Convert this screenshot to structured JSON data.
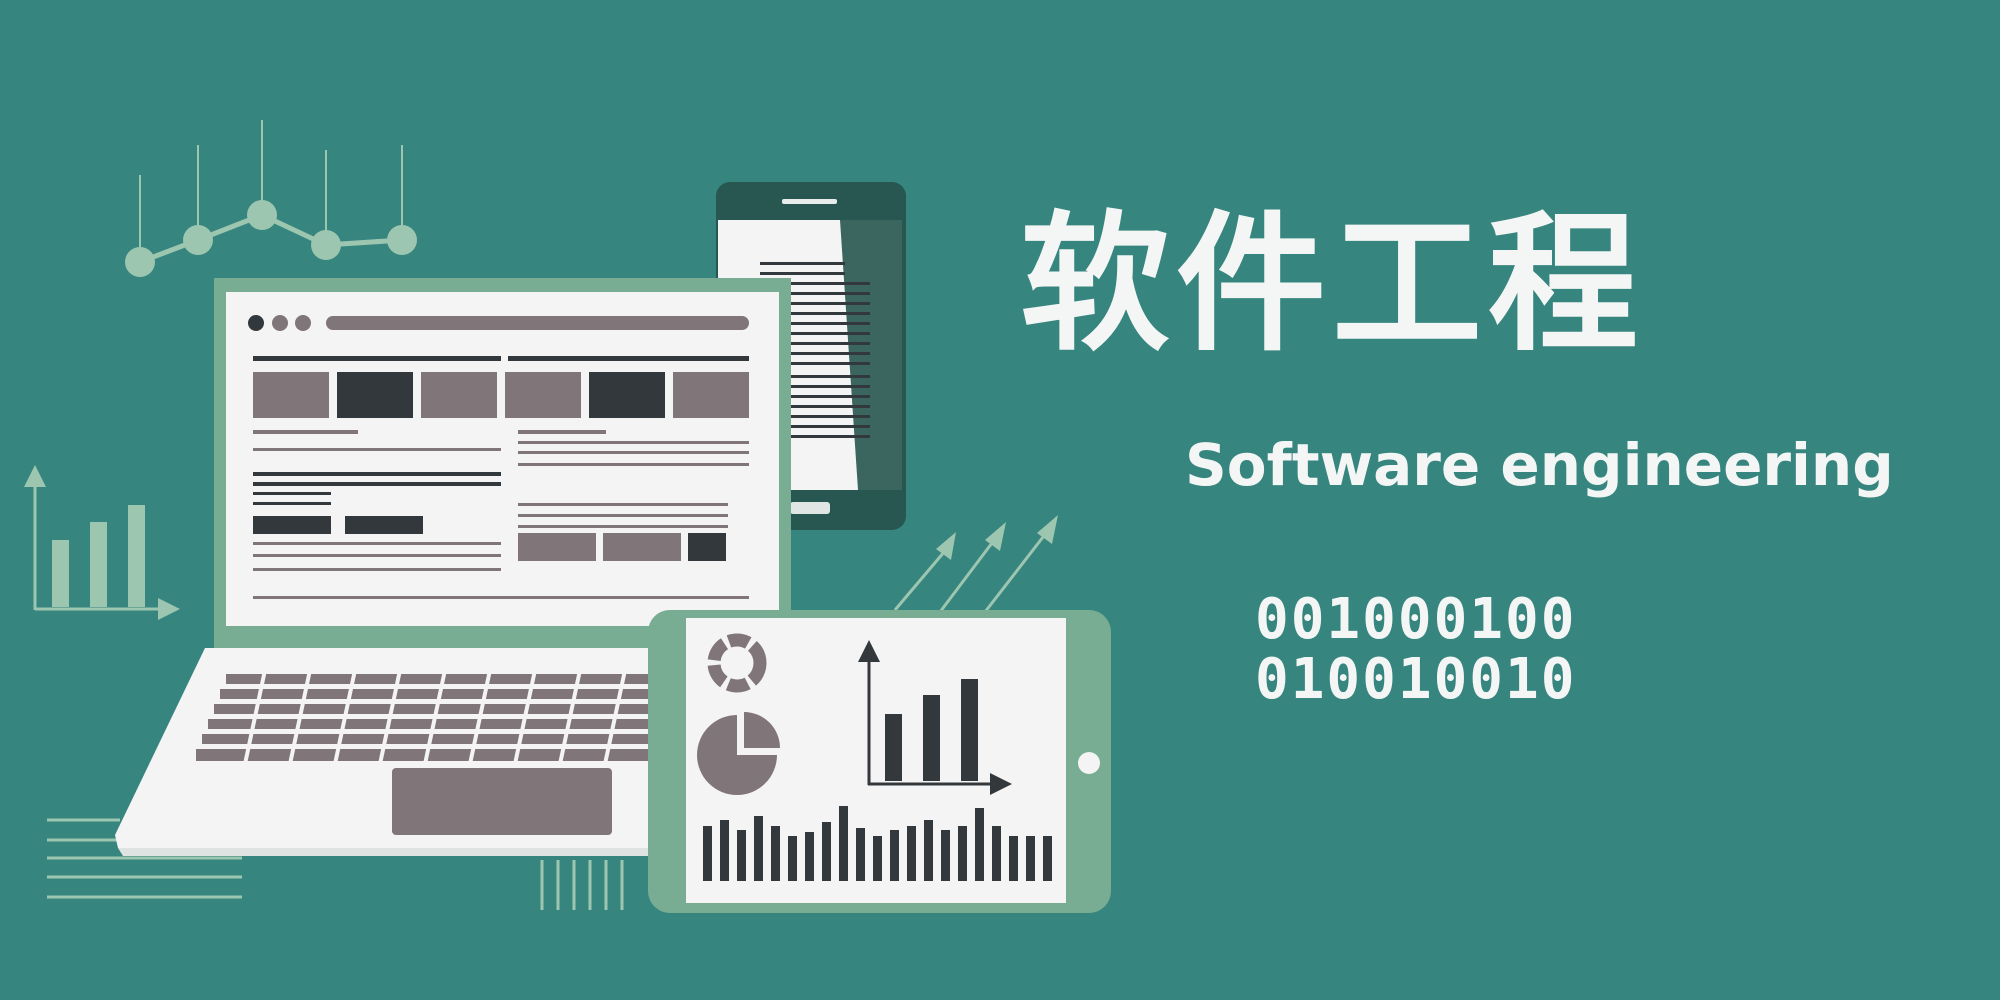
{
  "banner": {
    "title_zh": "软件工程",
    "title_en": "Software engineering",
    "binary_line_1": "001000100",
    "binary_line_2": "010010010"
  },
  "colors": {
    "background": "#36857e",
    "text": "#f4f6f5",
    "light_green": "#9cc6b0",
    "device_frame": "#78ad94",
    "screen": "#f4f4f4",
    "dark_gray": "#33383d",
    "mauve": "#807579",
    "phone_frame": "#275750"
  },
  "icons": [
    "laptop-icon",
    "phone-icon",
    "tablet-icon",
    "line-chart-icon",
    "bar-chart-icon",
    "growth-arrows-icon",
    "donut-chart-icon",
    "pie-chart-icon"
  ]
}
